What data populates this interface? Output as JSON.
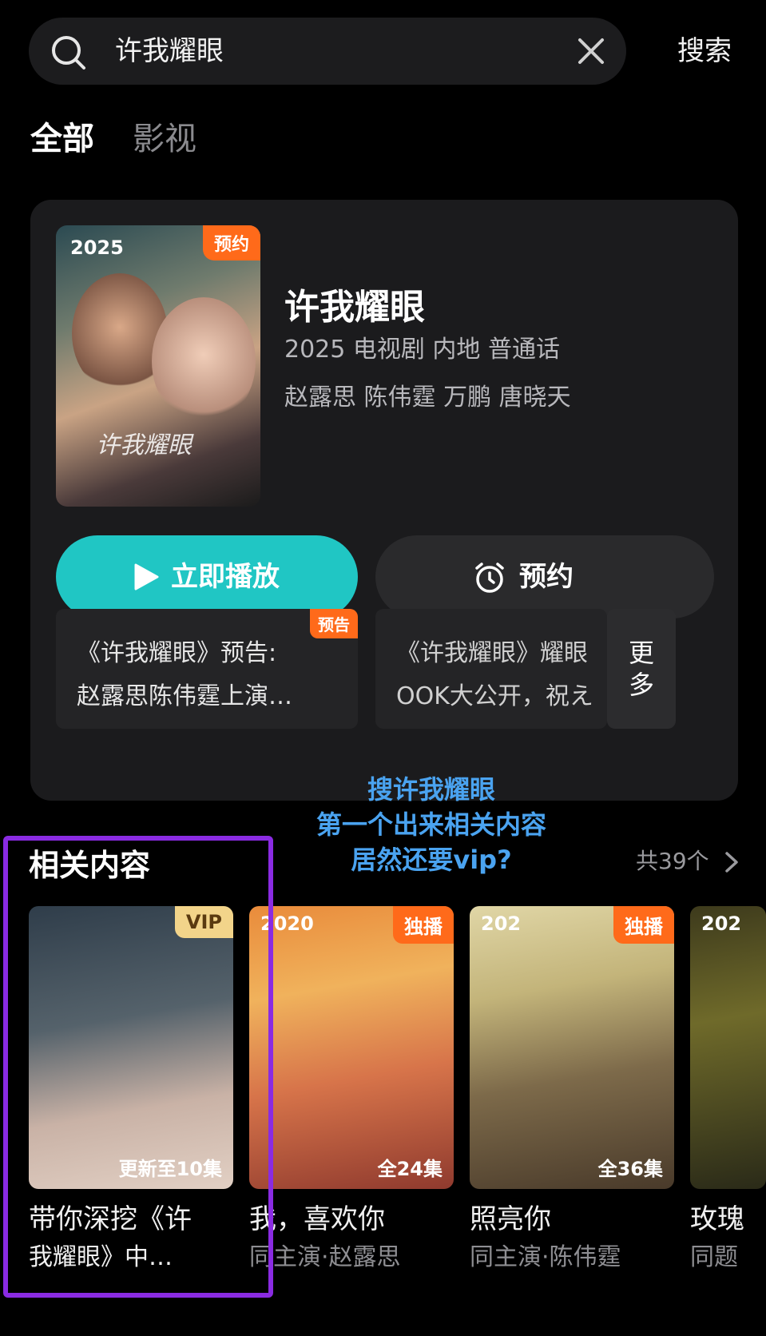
{
  "search": {
    "query": "许我耀眼",
    "button_label": "搜索"
  },
  "tabs": [
    {
      "label": "全部"
    },
    {
      "label": "影视"
    }
  ],
  "main_result": {
    "year": "2025",
    "badge": "预约",
    "poster_script": "许我耀眼",
    "title": "许我耀眼",
    "meta": "2025 电视剧 内地 普通话",
    "cast": "赵露思 陈伟霆 万鹏 唐晓天",
    "play_label": "立即播放",
    "reserve_label": "预约",
    "clips": [
      {
        "badge": "预告",
        "line1": "《许我耀眼》预告:",
        "line2": "赵露思陈伟霆上演…"
      },
      {
        "line1": "《许我耀眼》耀眼",
        "line2": "OOK大公开，祝え"
      }
    ],
    "more_label_top": "更",
    "more_label_bottom": "多"
  },
  "annotation": {
    "line1": "搜许我耀眼",
    "line2": "第一个出来相关内容",
    "line3": "居然还要vip?"
  },
  "related": {
    "title": "相关内容",
    "count": "共39个",
    "items": [
      {
        "badge": "VIP",
        "episodes": "更新至10集",
        "name": "带你深挖《许",
        "sub": "我耀眼》中…"
      },
      {
        "badge": "独播",
        "year": "2020",
        "episodes": "全24集",
        "name": "我，喜欢你",
        "sub": "同主演·赵露思"
      },
      {
        "badge": "独播",
        "year": "202",
        "episodes": "全36集",
        "name": "照亮你",
        "sub": "同主演·陈伟霆"
      },
      {
        "year": "202",
        "name": "玫瑰",
        "sub": "同题"
      }
    ]
  },
  "colors": {
    "accent": "#20c6c4",
    "badge_orange": "#ff6a1a",
    "highlight": "#8a2be2",
    "annotation": "#4aa3f0"
  },
  "icons": [
    "search-icon",
    "close-icon",
    "play-icon",
    "alarm-clock-icon",
    "chevron-right-icon"
  ]
}
